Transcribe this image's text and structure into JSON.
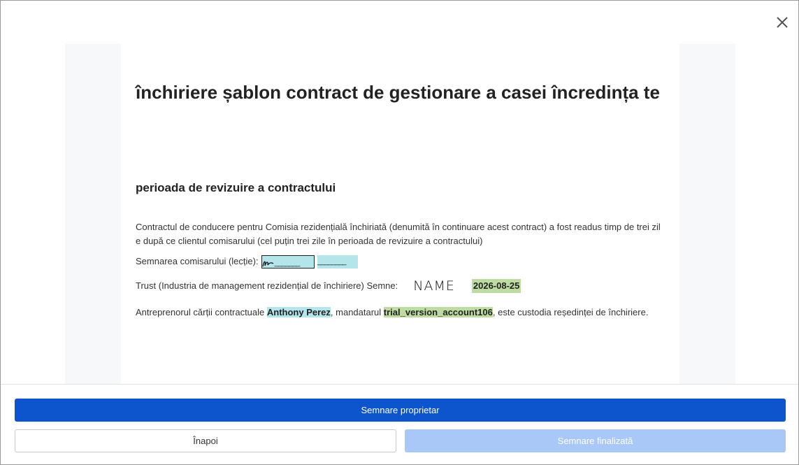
{
  "document": {
    "title": "închiriere șablon contract de gestionare a casei încredința te",
    "section_title": "perioada de revizuire a contractului",
    "paragraph1": "Contractul de conducere pentru Comisia rezidențială închiriată (denumită în continuare acest contract) a fost readus timp de trei zile după ce clientul comisarului (cel puțin trei zile în perioada de revizuire a contractului)",
    "commissioner_label": "Semnarea comisarului (lecție):",
    "sig_underline": "_______",
    "sig_blank": "________",
    "trust_label": "Trust (Industria de management rezidențial de închiriere) Semne:",
    "name_signature": "NAME",
    "trust_date": "2026-08-25",
    "para4_prefix": "Antreprenorul cărții contractuale",
    "para4_owner": "Anthony Perez",
    "para4_middle": ", mandatarul",
    "para4_account": "trial_version_account106",
    "para4_suffix": ", este custodia reședinței de închiriere."
  },
  "footer": {
    "primary_label": "Semnare proprietar",
    "back_label": "Înapoi",
    "done_label": "Semnare finalizată"
  },
  "colors": {
    "primary": "#0c55cc",
    "disabled": "#a9c8f8",
    "highlight_blue": "#b3e5eb",
    "highlight_green": "#bedca2"
  }
}
